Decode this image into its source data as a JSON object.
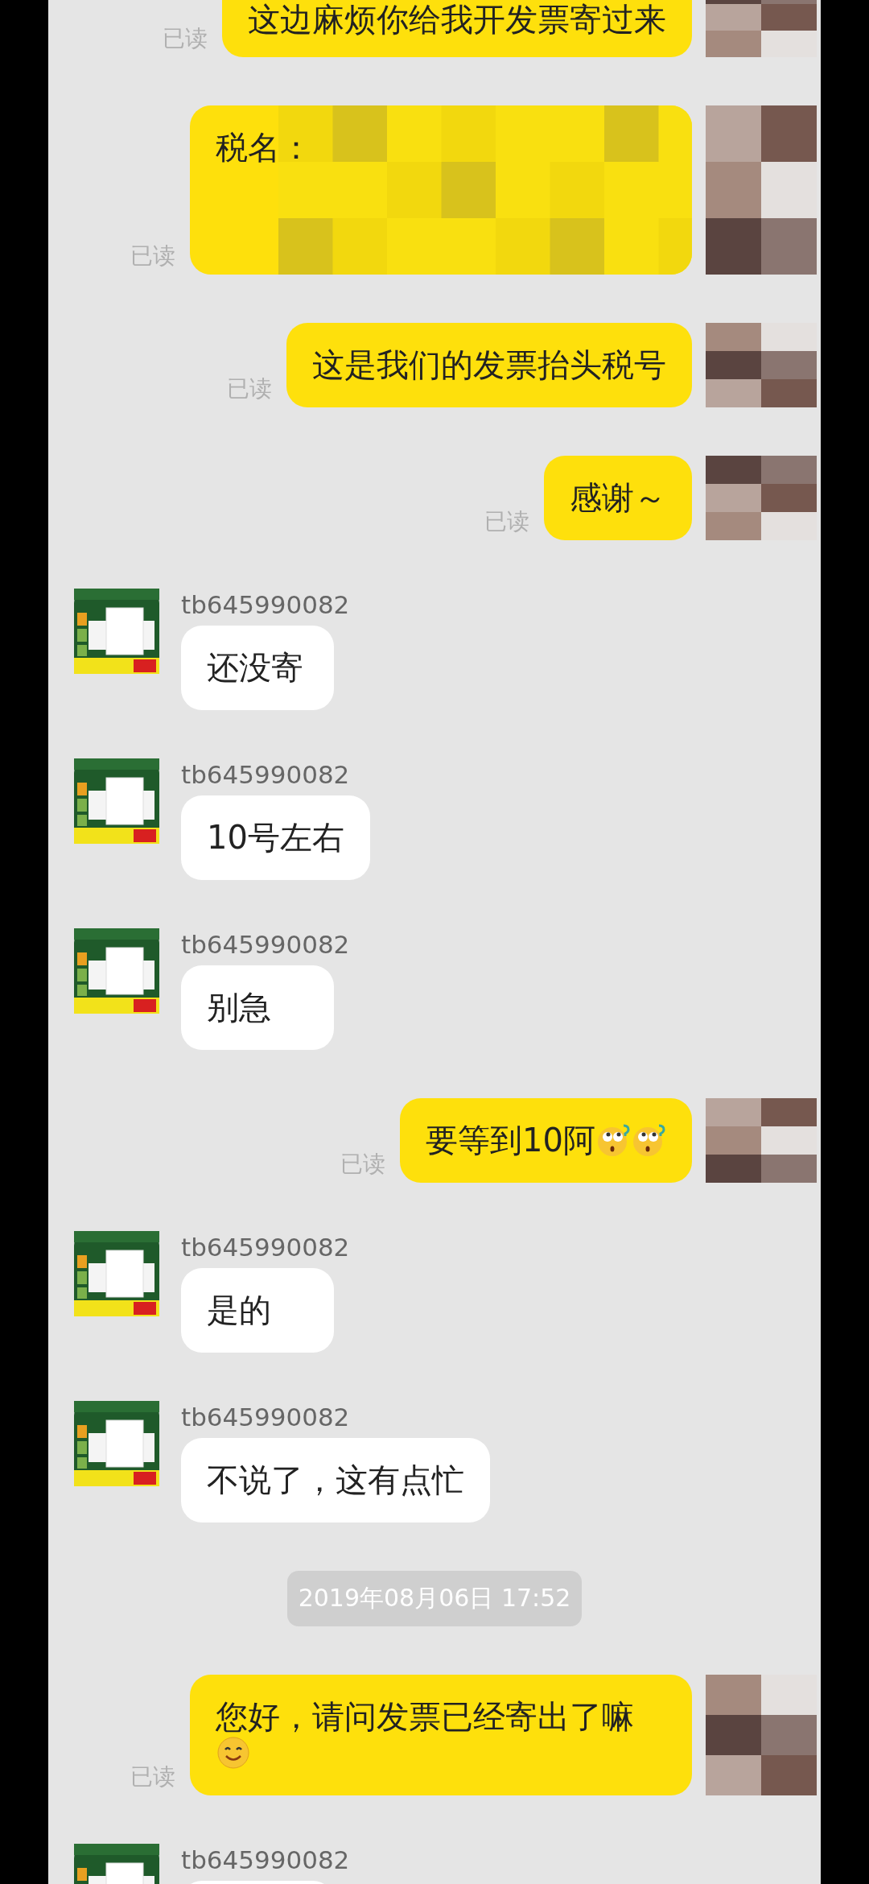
{
  "messages": [
    {
      "kind": "sent",
      "text": "这边麻烦你给我开发票寄过来",
      "status": "已读"
    },
    {
      "kind": "sent",
      "text": "税名：",
      "status": "已读",
      "redacted": true
    },
    {
      "kind": "sent",
      "text": "这是我们的发票抬头税号",
      "status": "已读"
    },
    {
      "kind": "sent",
      "text": "感谢～",
      "status": "已读"
    },
    {
      "kind": "received",
      "sender": "tb645990082",
      "text": "还没寄"
    },
    {
      "kind": "received",
      "sender": "tb645990082",
      "text": "10号左右"
    },
    {
      "kind": "received",
      "sender": "tb645990082",
      "text": "别急"
    },
    {
      "kind": "sent",
      "text": "要等到10阿",
      "status": "已读",
      "emoji": [
        {
          "kind": "puzzled"
        },
        {
          "kind": "puzzled"
        }
      ]
    },
    {
      "kind": "received",
      "sender": "tb645990082",
      "text": "是的"
    },
    {
      "kind": "received",
      "sender": "tb645990082",
      "text": "不说了，这有点忙"
    },
    {
      "kind": "time",
      "text": "2019年08月06日 17:52"
    },
    {
      "kind": "sent",
      "text": "您好，请问发票已经寄出了嘛",
      "status": "已读",
      "emoji": [
        {
          "kind": "smile"
        }
      ]
    },
    {
      "kind": "received",
      "sender": "tb645990082"
    }
  ]
}
